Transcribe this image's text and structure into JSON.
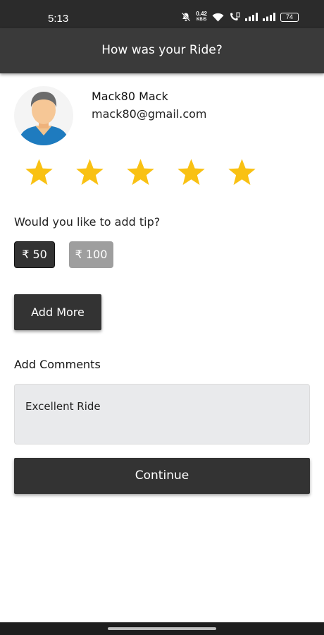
{
  "status_bar": {
    "time": "5:13",
    "network_speed": "0.42",
    "network_speed_unit": "KB/S",
    "battery": "74",
    "icons": [
      "mute-icon",
      "wifi-icon",
      "volte-call-icon",
      "signal-icon",
      "signal-icon",
      "battery-icon"
    ]
  },
  "header": {
    "title": "How was your Ride?",
    "background": "#3a3a3a"
  },
  "driver": {
    "name": "Mack80 Mack",
    "email": "mack80@gmail.com",
    "avatar_icon": "driver-avatar-icon"
  },
  "rating": {
    "value": 5,
    "max": 5,
    "star_color": "#f9c113"
  },
  "tip": {
    "question": "Would you like to add tip?",
    "options": [
      {
        "label": "₹ 50",
        "selected": true
      },
      {
        "label": "₹ 100",
        "selected": false
      }
    ]
  },
  "add_more_label": "Add More",
  "comments": {
    "label": "Add Comments",
    "value": "Excellent Ride"
  },
  "continue_label": "Continue",
  "colors": {
    "primary_dark": "#333333",
    "tip_unselected": "#9e9e9e",
    "comment_bg": "#e9eaec"
  }
}
